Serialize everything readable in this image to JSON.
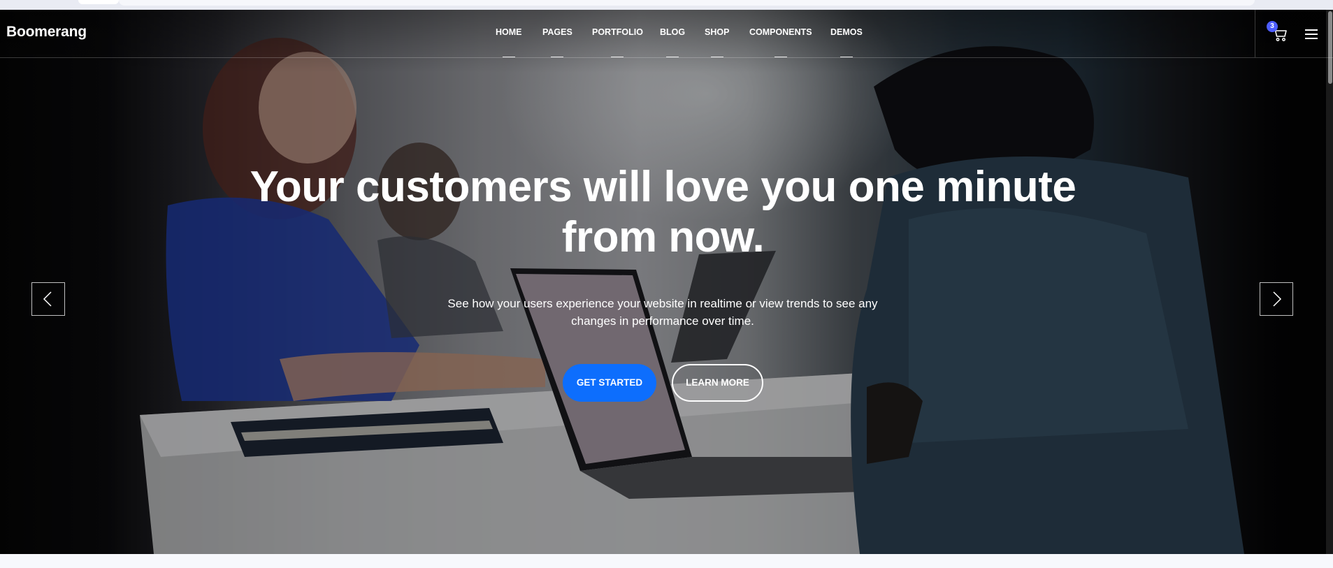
{
  "brand": {
    "name": "Boomerang"
  },
  "nav": {
    "items": [
      {
        "label": "HOME"
      },
      {
        "label": "PAGES"
      },
      {
        "label": "PORTFOLIO"
      },
      {
        "label": "BLOG"
      },
      {
        "label": "SHOP"
      },
      {
        "label": "COMPONENTS"
      },
      {
        "label": "DEMOS"
      }
    ]
  },
  "cart": {
    "count": "3",
    "icon": "cart-icon"
  },
  "menu": {
    "icon": "hamburger-menu-icon"
  },
  "hero": {
    "headline": "Your customers will love you one minute from now.",
    "subtext": "See how your users experience your website in realtime or view trends to see any changes in performance over time.",
    "primary_button": "GET STARTED",
    "secondary_button": "LEARN MORE",
    "prev_icon": "chevron-left-icon",
    "next_icon": "chevron-right-icon"
  },
  "colors": {
    "primary": "#0d6efd",
    "badge": "#4d5dff",
    "text": "#ffffff"
  }
}
